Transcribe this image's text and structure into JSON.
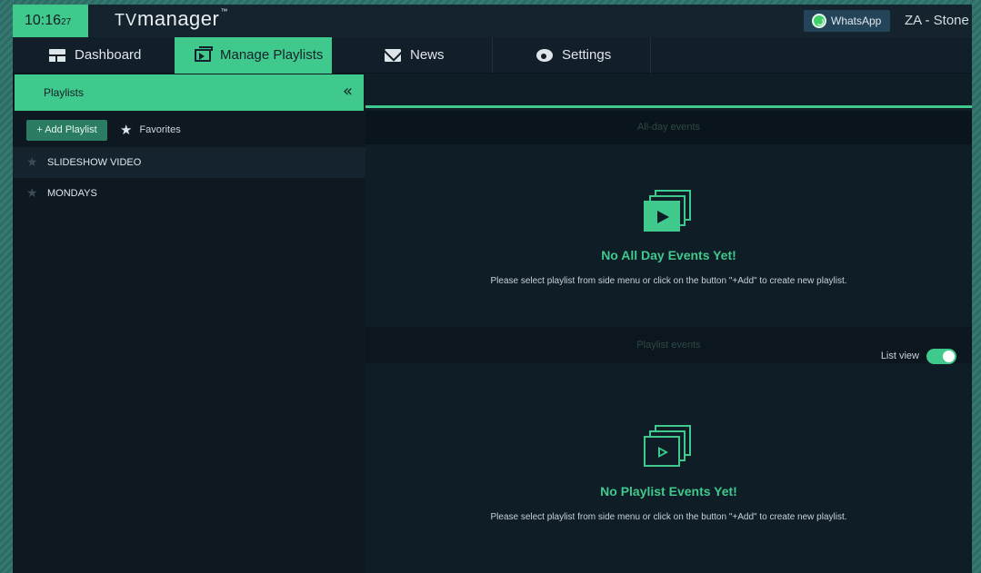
{
  "header": {
    "clock_hm": "10:16",
    "clock_sec": "27",
    "brand_tv": "TV",
    "brand_name": "manager",
    "brand_tm": "™",
    "whatsapp_label": "WhatsApp",
    "account_label": "ZA - Stone C"
  },
  "nav": {
    "tabs": [
      {
        "label": "Dashboard",
        "icon": "dashboard-icon"
      },
      {
        "label": "Manage Playlists",
        "icon": "playlist-icon",
        "active": true
      },
      {
        "label": "News",
        "icon": "mail-icon"
      },
      {
        "label": "Settings",
        "icon": "gear-icon"
      }
    ]
  },
  "sidebar": {
    "title": "Playlists",
    "collapse_glyph": "«",
    "add_label": "+ Add Playlist",
    "favorites_label": "Favorites",
    "playlists": [
      {
        "name": "SLIDESHOW VIDEO"
      },
      {
        "name": "MONDAYS"
      }
    ]
  },
  "main": {
    "allday": {
      "section_label": "All-day events",
      "empty_title": "No All Day Events Yet!",
      "empty_text": "Please select playlist from side menu or click on the button \"+Add\" to create new playlist."
    },
    "playlist_events": {
      "section_label": "Playlist events",
      "list_view_label": "List view",
      "list_view_on": true,
      "empty_title": "No Playlist Events Yet!",
      "empty_text": "Please select playlist from side menu or click on the button \"+Add\" to create new playlist."
    }
  },
  "colors": {
    "accent": "#40c98c",
    "background": "#0f1d27"
  }
}
